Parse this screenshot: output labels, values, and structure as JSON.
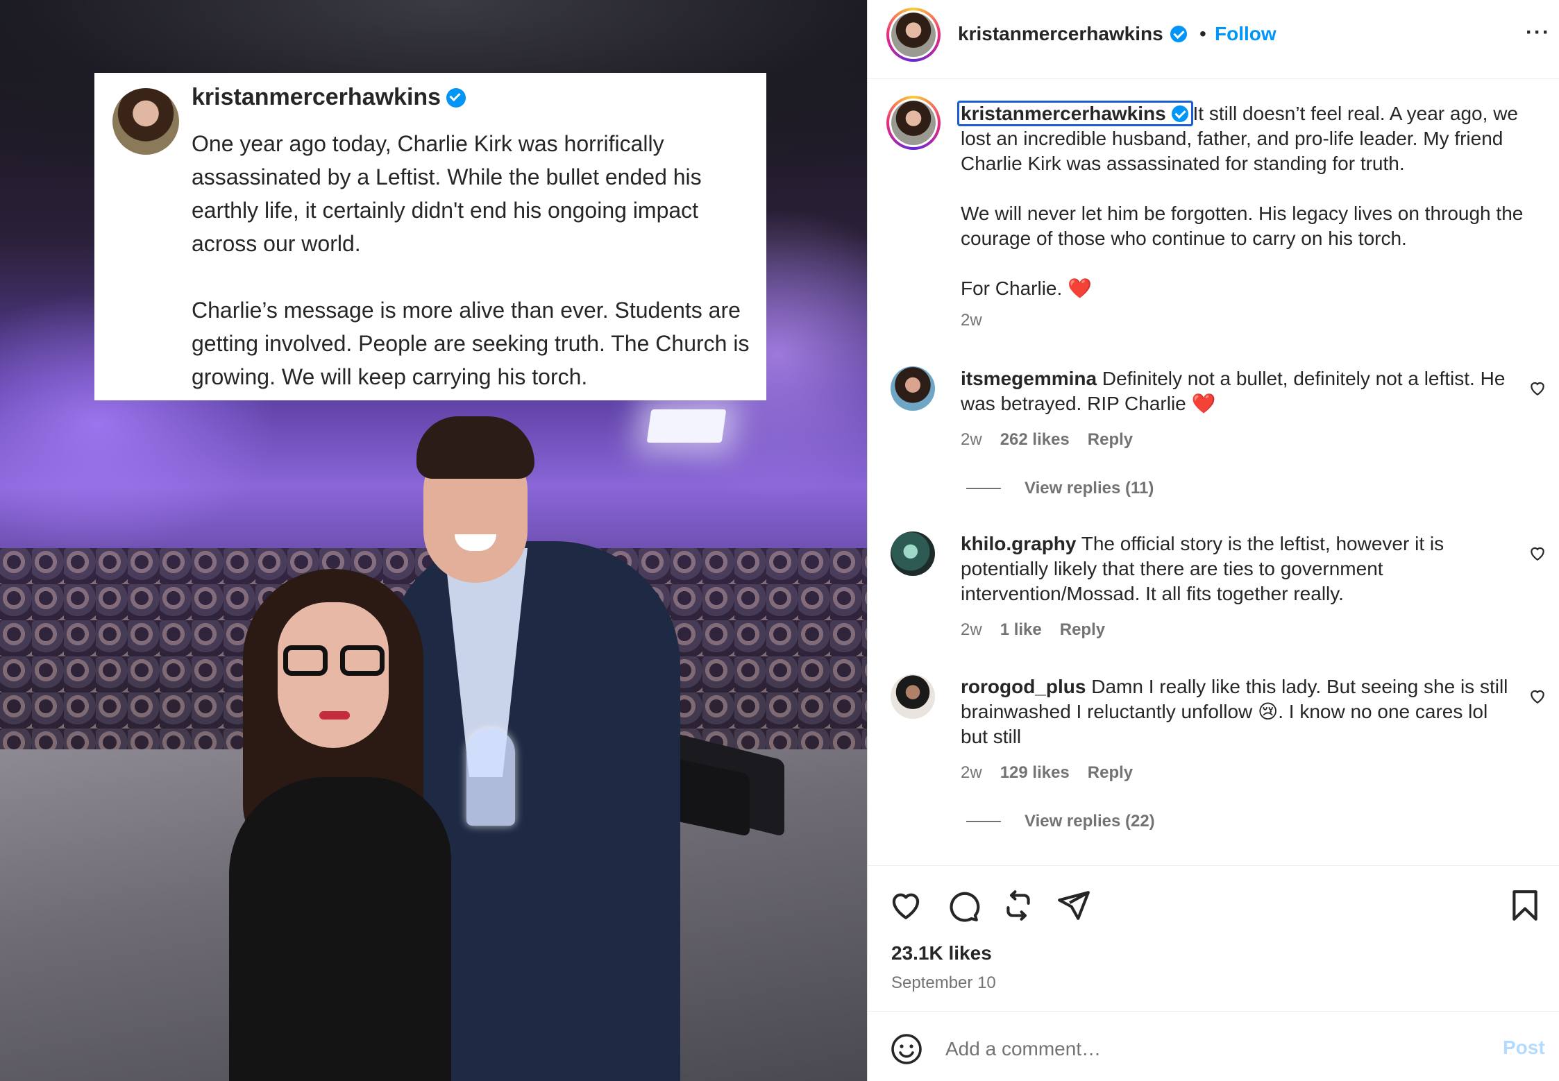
{
  "media": {
    "card": {
      "username": "kristanmercerhawkins",
      "paragraphs": [
        "One year ago today, Charlie Kirk was horrifically assassinated by a Leftist. While the bullet ended his earthly life, it certainly didn't end his ongoing impact across our world.",
        "Charlie’s message is more alive than ever. Students are getting involved. People are seeking truth. The Church is growing. We will keep carrying his torch."
      ]
    }
  },
  "header": {
    "username": "kristanmercerhawkins",
    "dot": "•",
    "follow_label": "Follow",
    "more_label": "···"
  },
  "caption": {
    "username": "kristanmercerhawkins",
    "line1": "It still doesn’t feel real. A year ago, we lost an incredible husband, father, and pro-life leader. My friend Charlie Kirk was assassinated for standing for truth.",
    "line2": "We will never let him be forgotten. His legacy lives on through the courage of those who continue to carry on his torch.",
    "line3": "For Charlie.",
    "emoji": "❤️",
    "time": "2w"
  },
  "comments": [
    {
      "username": "itsmegemmina",
      "text": "Definitely not a bullet, definitely not a leftist. He was betrayed. RIP Charlie",
      "emoji": "❤️",
      "time": "2w",
      "likes": "262 likes",
      "reply": "Reply",
      "view_replies": "View replies (11)"
    },
    {
      "username": "khilo.graphy",
      "text": "The official story is the leftist, however it is potentially likely that there are ties to government intervention/Mossad. It all fits together really.",
      "emoji": "",
      "time": "2w",
      "likes": "1 like",
      "reply": "Reply",
      "view_replies": ""
    },
    {
      "username": "rorogod_plus",
      "text_before": "Damn I really like this lady. But seeing she is still brainwashed I reluctantly unfollow",
      "emoji": "😢",
      "text_after": ". I know no one cares lol but still",
      "time": "2w",
      "likes": "129 likes",
      "reply": "Reply",
      "view_replies": "View replies (22)"
    }
  ],
  "footer": {
    "likes": "23.1K likes",
    "date": "September 10",
    "comment_placeholder": "Add a comment…",
    "post_label": "Post"
  },
  "icons": {
    "like": "heart-icon",
    "comment": "comment-icon",
    "repost": "repost-icon",
    "share": "send-icon",
    "save": "bookmark-icon",
    "emoji": "emoji-icon",
    "more": "more-icon",
    "verified": "verified-badge-icon"
  },
  "colors": {
    "accent": "#0095f6",
    "caption_highlight": "#1a5bd6",
    "secondary_text": "#737373",
    "post_disabled": "#b3dbff"
  }
}
